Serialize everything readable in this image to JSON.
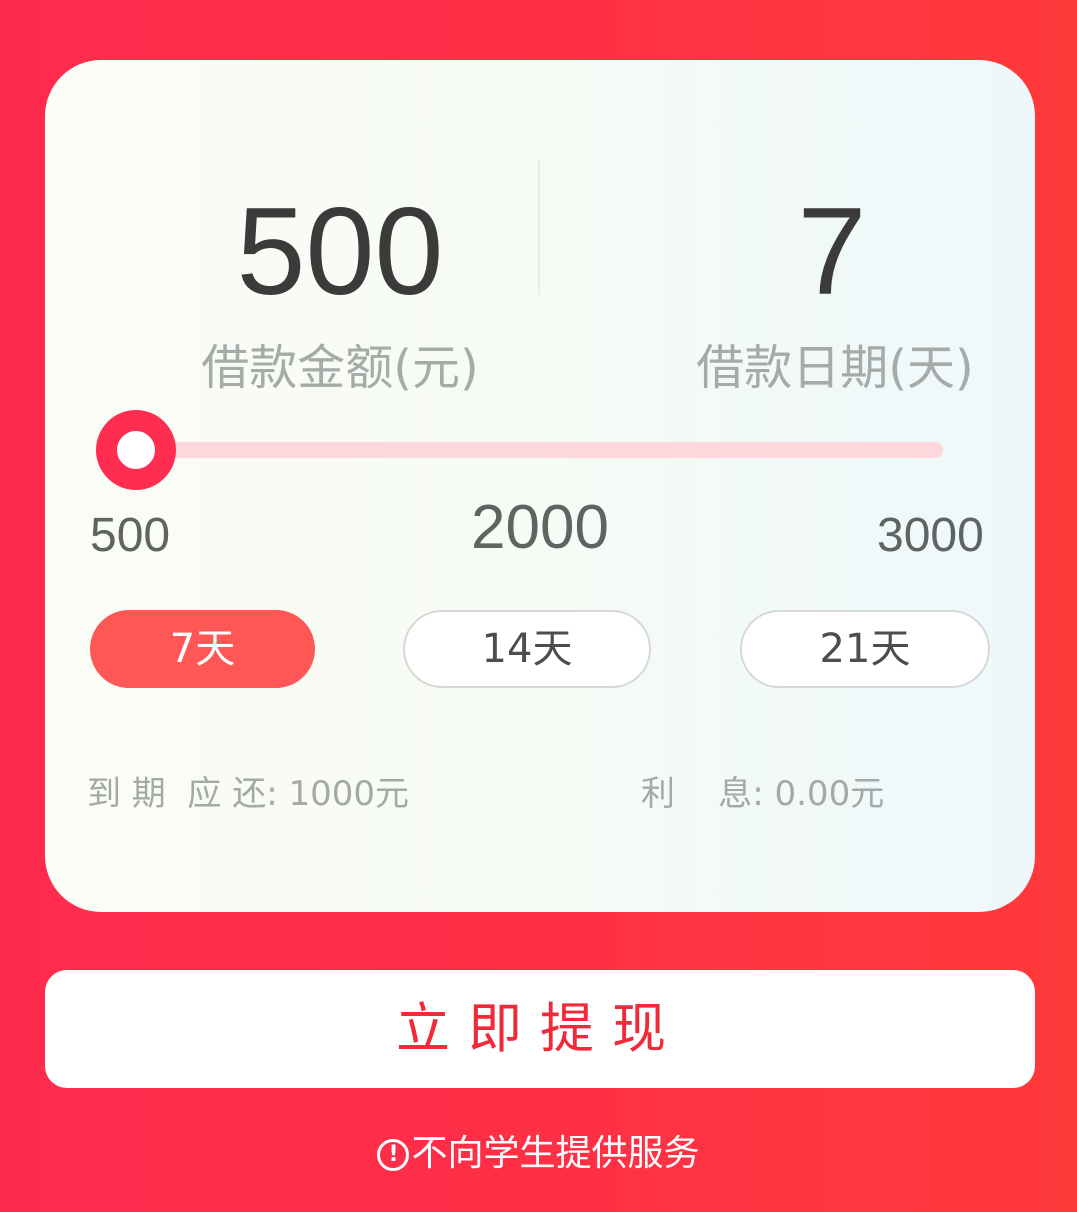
{
  "summary": {
    "amount_value": "500",
    "amount_caption": "借款金额(元)",
    "days_value": "7",
    "days_caption": "借款日期(天)"
  },
  "slider": {
    "level": 0.0,
    "min_label": "500",
    "current_label": "2000",
    "max_label": "3000",
    "track_color": "#fdd7db",
    "thumb_color": "#ff2d4f"
  },
  "terms": [
    {
      "label": "7天",
      "selected": true
    },
    {
      "label": "14天",
      "selected": false
    },
    {
      "label": "21天",
      "selected": false
    }
  ],
  "info": {
    "due_text": "到 期  应 还: 1000元",
    "interest_text": "利    息: 0.00元"
  },
  "withdraw_button": {
    "label": "立即提现"
  },
  "notice": {
    "icon": "exclamation-circle-icon",
    "icon_glyph": "!",
    "text": "不向学生提供服务"
  },
  "colors": {
    "background_red": "#ff2b4f",
    "selected_term": "#ff5656",
    "withdraw_text": "#ef2b3a"
  }
}
